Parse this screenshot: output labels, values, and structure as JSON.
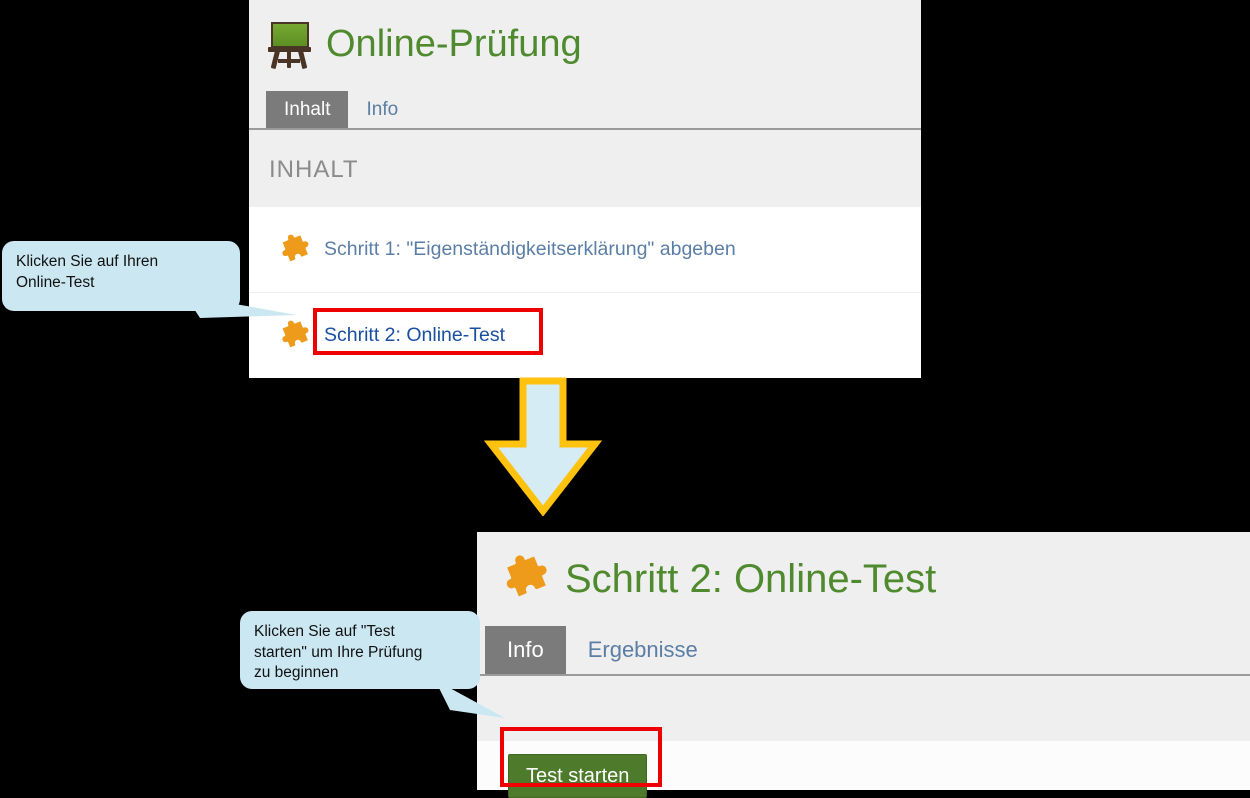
{
  "upper_panel": {
    "app_icon": "easel-blackboard-icon",
    "title": "Online-Prüfung",
    "tabs": [
      {
        "label": "Inhalt",
        "active": true
      },
      {
        "label": "Info",
        "active": false
      }
    ],
    "section_header": "INHALT",
    "rows": [
      {
        "icon": "puzzle-piece-icon",
        "label": "Schritt 1: \"Eigenständigkeitserklärung\" abgeben",
        "highlighted": false
      },
      {
        "icon": "puzzle-piece-icon",
        "label": "Schritt 2: Online-Test",
        "highlighted": true
      }
    ]
  },
  "lower_panel": {
    "icon": "puzzle-piece-icon",
    "title": "Schritt 2: Online-Test",
    "tabs": [
      {
        "label": "Info",
        "active": true
      },
      {
        "label": "Ergebnisse",
        "active": false
      }
    ],
    "start_button": "Test starten"
  },
  "callouts": [
    {
      "text": "Klicken Sie auf Ihren\nOnline-Test"
    },
    {
      "text": "Klicken Sie auf \"Test\nstarten\" um Ihre Prüfung\nzu beginnen"
    }
  ],
  "annotations": {
    "arrow_icon": "down-arrow-icon",
    "highlight_step2": "red-highlight-box",
    "highlight_test_starten": "red-highlight-box"
  },
  "colors": {
    "title_green": "#4f8a2e",
    "link_blue": "#5b7ea6",
    "highlight_link_blue": "#1a4fa0",
    "puzzle_orange": "#ee9b1c",
    "active_tab_gray": "#7b7b7b",
    "panel_gray": "#efefef",
    "callout_blue": "#cbe8f2",
    "highlight_red": "#ee0000",
    "arrow_outline": "#ffc20e",
    "arrow_fill": "#d6ecf4",
    "button_green": "#4e7b2b"
  }
}
